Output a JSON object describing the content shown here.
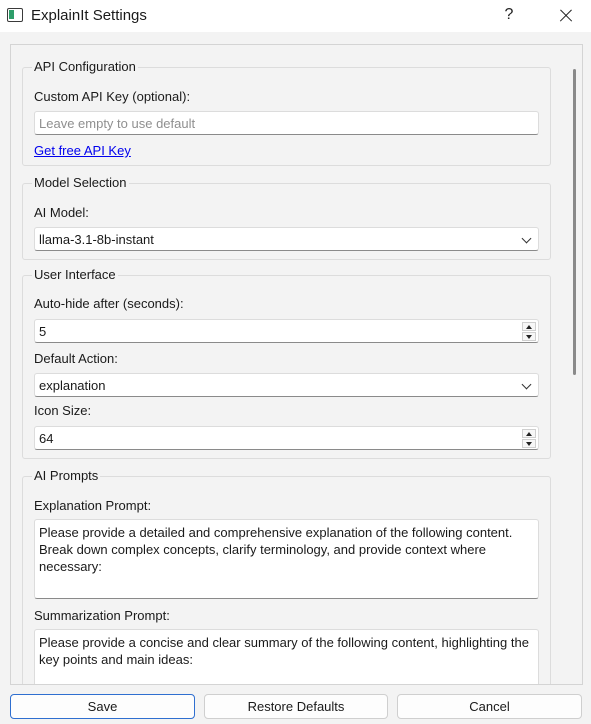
{
  "window": {
    "title": "ExplainIt Settings",
    "help_label": "?"
  },
  "api": {
    "group_title": "API Configuration",
    "key_label": "Custom API Key (optional):",
    "key_placeholder": "Leave empty to use default",
    "key_value": "",
    "link_label": "Get free API Key"
  },
  "model": {
    "group_title": "Model Selection",
    "label": "AI Model:",
    "selected": "llama-3.1-8b-instant"
  },
  "ui": {
    "group_title": "User Interface",
    "autohide_label": "Auto-hide after (seconds):",
    "autohide_value": "5",
    "action_label": "Default Action:",
    "action_selected": "explanation",
    "icon_size_label": "Icon Size:",
    "icon_size_value": "64"
  },
  "prompts": {
    "group_title": "AI Prompts",
    "explanation_label": "Explanation Prompt:",
    "explanation_text": "Please provide a detailed and comprehensive explanation of the following content. Break down complex concepts, clarify terminology, and provide context where necessary:",
    "summary_label": "Summarization Prompt:",
    "summary_text": "Please provide a concise and clear summary of the following content, highlighting the key points and main ideas:"
  },
  "buttons": {
    "save": "Save",
    "restore": "Restore Defaults",
    "cancel": "Cancel"
  }
}
